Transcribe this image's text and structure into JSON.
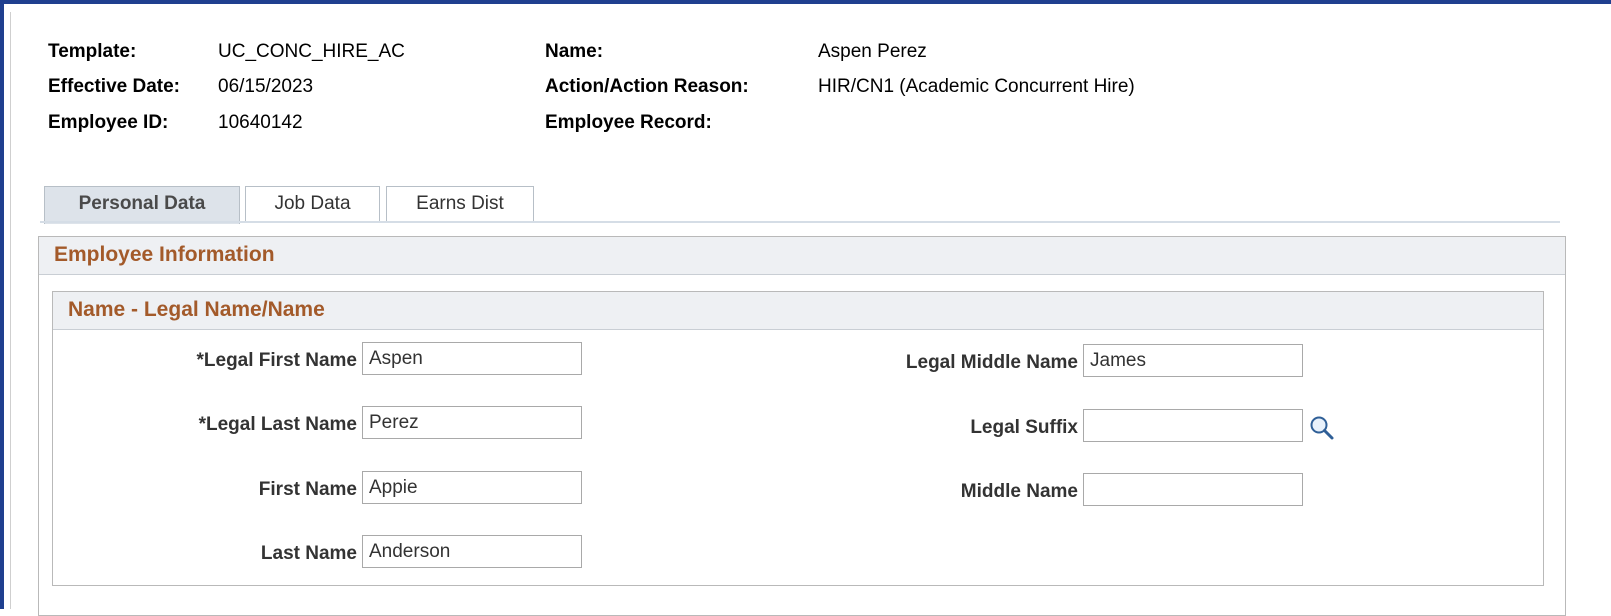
{
  "header": {
    "template_label": "Template:",
    "template_value": "UC_CONC_HIRE_AC",
    "effective_date_label": "Effective Date:",
    "effective_date_value": "06/15/2023",
    "employee_id_label": "Employee ID:",
    "employee_id_value": "10640142",
    "name_label": "Name:",
    "name_value": "Aspen Perez",
    "action_label": "Action/Action Reason:",
    "action_value": "HIR/CN1 (Academic Concurrent Hire)",
    "employee_record_label": "Employee Record:",
    "employee_record_value": ""
  },
  "tabs": [
    {
      "label": "Personal Data",
      "active": true
    },
    {
      "label": "Job Data",
      "active": false
    },
    {
      "label": "Earns Dist",
      "active": false
    }
  ],
  "employee_information": {
    "title": "Employee Information"
  },
  "name_section": {
    "title": "Name - Legal Name/Name",
    "legal_first_name": {
      "label": "*Legal First Name",
      "value": "Aspen"
    },
    "legal_last_name": {
      "label": "*Legal Last Name",
      "value": "Perez"
    },
    "first_name": {
      "label": "First Name",
      "value": "Appie"
    },
    "last_name": {
      "label": "Last Name",
      "value": "Anderson"
    },
    "legal_middle_name": {
      "label": "Legal Middle Name",
      "value": "James"
    },
    "legal_suffix": {
      "label": "Legal Suffix",
      "value": ""
    },
    "middle_name": {
      "label": "Middle Name",
      "value": ""
    }
  },
  "icons": {
    "lookup": "magnifier-lookup-icon"
  },
  "colors": {
    "frame_border": "#1f3f8f",
    "section_title": "#a35a2a",
    "active_tab_bg": "#dde3ea"
  }
}
